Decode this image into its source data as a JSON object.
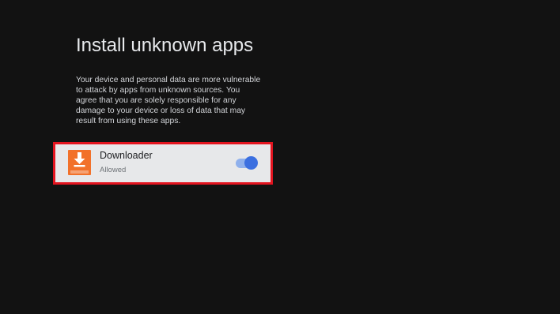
{
  "page": {
    "title": "Install unknown apps",
    "warning": "Your device and personal data are more vulnerable to attack by apps from unknown sources. You agree that you are solely responsible for any damage to your device or loss of data that may result from using these apps."
  },
  "app_item": {
    "name": "Downloader",
    "status": "Allowed",
    "icon": "downloader-app-icon",
    "toggle_on": true
  },
  "colors": {
    "background": "#121212",
    "card": "#e7e8ea",
    "highlight": "#e3141f",
    "accent": "#3b6fe0",
    "app_icon": "#f2712a"
  }
}
